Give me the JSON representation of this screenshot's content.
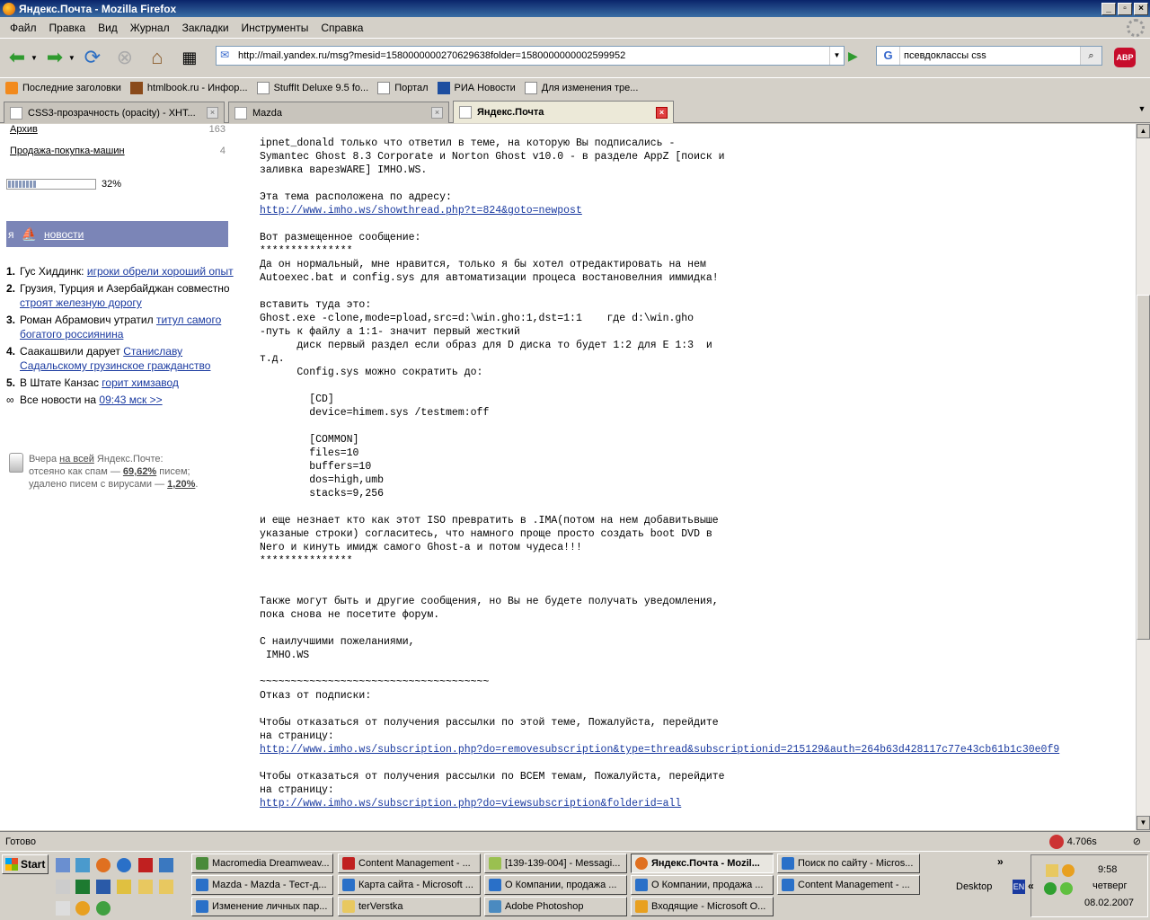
{
  "window": {
    "title": "Яндекс.Почта - Mozilla Firefox"
  },
  "menu": [
    "Файл",
    "Правка",
    "Вид",
    "Журнал",
    "Закладки",
    "Инструменты",
    "Справка"
  ],
  "url": "http://mail.yandex.ru/msg?mesid=1580000000270629638folder=1580000000002599952",
  "search": {
    "engine": "G",
    "value": "псевдоклассы css"
  },
  "bookmarks": [
    "Последние заголовки",
    "htmlbook.ru - Инфор...",
    "StuffIt Deluxe 9.5 fo...",
    "Портал",
    "РИА Новости",
    "Для изменения тре..."
  ],
  "tabs": [
    "CSS3-прозрачность (opacity) - ХНТ...",
    "Mazda",
    "Яндекс.Почта"
  ],
  "sidebar": {
    "folders": [
      {
        "name": "Архив",
        "count": "163"
      },
      {
        "name": "Продажа-покупка-машин",
        "count": "4"
      }
    ],
    "quota": {
      "percent": 32,
      "label": "32%"
    },
    "news_prefix": "я",
    "news_link": "новости",
    "news": [
      {
        "num": "1.",
        "text": "Гус Хиддинк: ",
        "link": "игроки обрели хороший опыт"
      },
      {
        "num": "2.",
        "text": "Грузия, Турция и Азербайджан совместно ",
        "link": "строят железную дорогу"
      },
      {
        "num": "3.",
        "text": "Роман Абрамович утратил ",
        "link": "титул самого богатого россиянина"
      },
      {
        "num": "4.",
        "text": "Саакашвили дарует ",
        "link": "Станиславу Садальскому грузинское гражданство"
      },
      {
        "num": "5.",
        "text": "В Штате Канзас ",
        "link": "горит химзавод"
      }
    ],
    "all_news": {
      "symbol": "∞",
      "text": "Все новости на ",
      "link": "09:43 мск >>"
    },
    "spam": {
      "line1_a": "Вчера ",
      "line1_link": "на всей",
      "line1_b": " Яндекс.Почте:",
      "line2_a": "отсеяно как спам — ",
      "line2_val": "69,62%",
      "line2_b": " писем;",
      "line3_a": "удалено писем с вирусами — ",
      "line3_val": "1,20%",
      "line3_b": "."
    }
  },
  "message": {
    "p1": "ipnet_donald только что ответил в теме, на которую Вы подписались -\nSymantec Ghost 8.3 Corporate и Norton Ghost v10.0 - в разделе AppZ [поиск и\nзаливка варезWARE] IMHO.WS.\n\nЭта тема расположена по адресу:\n",
    "link1": "http://www.imho.ws/showthread.php?t=824&goto=newpost",
    "p2": "\n\nВот размещенное сообщение:\n***************\nДа он нормальный, мне нравится, только я бы хотел отредактировать на нем\nAutoexec.bat и config.sys для автоматизации процеса востановелния иммидка!\n\nвставить туда это:\nGhost.exe -clone,mode=pload,src=d:\\win.gho:1,dst=1:1    где d:\\win.gho\n-путь к файлу а 1:1- значит первый жесткий\n      диск первый раздел если образ для D диска то будет 1:2 для E 1:3  и\nт.д.\n      Config.sys можно сократить до:\n\n        [CD]\n        device=himem.sys /testmem:off\n\n        [COMMON]\n        files=10\n        buffers=10\n        dos=high,umb\n        stacks=9,256\n\nи еще незнает кто как этот ISO превратить в .IMA(потом на нем добавитьвыше\nуказаные строки) согласитесь, что намного проще просто создать boot DVD в\nNero и кинуть имидж самого Ghost-а и потом чудеса!!!\n***************\n\n\nТакже могут быть и другие сообщения, но Вы не будете получать уведомления,\nпока снова не посетите форум.\n\nС наилучшими пожеланиями,\n IMHO.WS\n\n~~~~~~~~~~~~~~~~~~~~~~~~~~~~~~~~~~~~~\nОтказ от подписки:\n\nЧтобы отказаться от получения рассылки по этой теме, Пожалуйста, перейдите\nна страницу:\n",
    "link2": "http://www.imho.ws/subscription.php?do=removesubscription&type=thread&subscriptionid=215129&auth=264b63d428117c77e43cb61b1c30e0f9",
    "p3": "\n\nЧтобы отказаться от получения рассылки по ВСЕМ темам, Пожалуйста, перейдите\nна страницу:\n",
    "link3": "http://www.imho.ws/subscription.php?do=viewsubscription&folderid=all"
  },
  "status": {
    "text": "Готово",
    "ya_value": "4.706s"
  },
  "taskbar": {
    "start": "Start",
    "tasks": [
      "Macromedia Dreamweav...",
      "Content Management - ...",
      "[139-139-004] - Messagi...",
      "Яндекс.Почта - Mozil...",
      "Поиск по сайту - Micros...",
      "Mazda - Mazda - Тест-д...",
      "Карта сайта - Microsoft ...",
      "О Компании, продажа ...",
      "О Компании, продажа ...",
      "Content Management - ...",
      "Изменение личных пар...",
      "terVerstka",
      "Adobe Photoshop",
      "Входящие - Microsoft O..."
    ],
    "more": "»",
    "desktop": "Desktop",
    "lang": "EN",
    "time": "9:58",
    "day": "четверг",
    "date": "08.02.2007"
  }
}
